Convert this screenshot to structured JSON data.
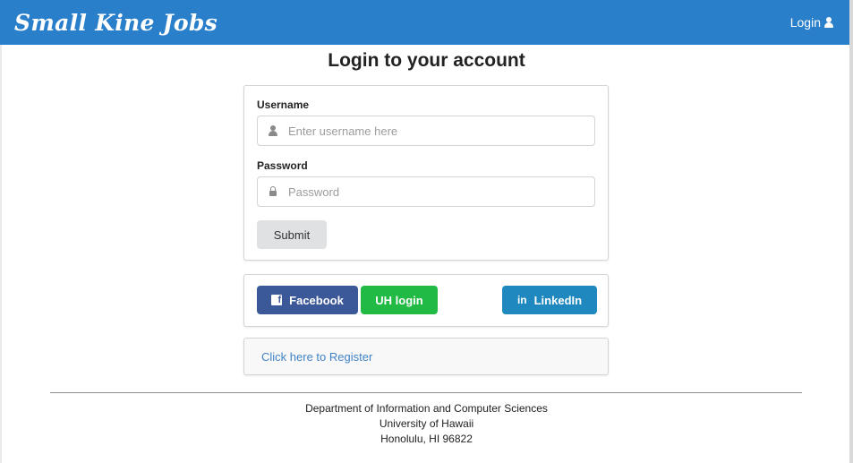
{
  "header": {
    "brand": "Small Kine Jobs",
    "login_label": "Login"
  },
  "page_title": "Login to your account",
  "form": {
    "username_label": "Username",
    "username_placeholder": "Enter username here",
    "password_label": "Password",
    "password_placeholder": "Password",
    "submit_label": "Submit"
  },
  "social": {
    "facebook_label": "Facebook",
    "uh_label": "UH login",
    "linkedin_label": "LinkedIn"
  },
  "register_link": "Click here to Register",
  "footer": {
    "line1": "Department of Information and Computer Sciences",
    "line2": "University of Hawaii",
    "line3": "Honolulu, HI 96822"
  },
  "colors": {
    "topbar": "#2a7fca",
    "facebook": "#3b5998",
    "uh_login": "#21ba45",
    "linkedin": "#1f88be",
    "link": "#4183c4"
  },
  "icons": [
    "user-icon",
    "lock-icon",
    "facebook-icon",
    "linkedin-icon"
  ]
}
